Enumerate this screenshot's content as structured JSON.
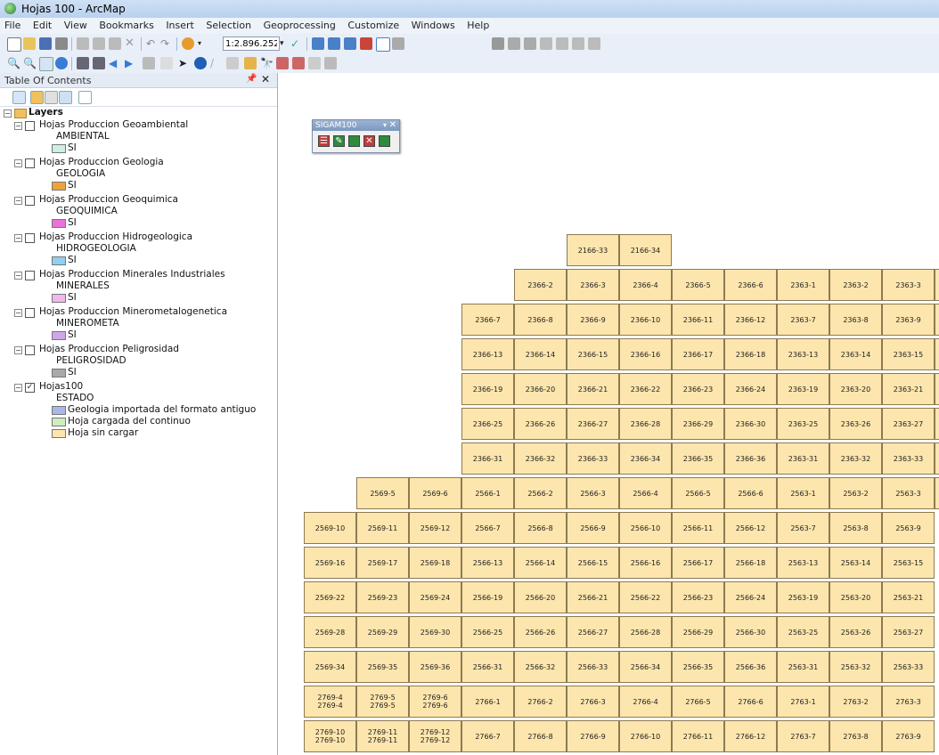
{
  "window": {
    "title": "Hojas 100 - ArcMap"
  },
  "menu": [
    "File",
    "Edit",
    "View",
    "Bookmarks",
    "Insert",
    "Selection",
    "Geoprocessing",
    "Customize",
    "Windows",
    "Help"
  ],
  "toolbar": {
    "scale": "1:2.896.252"
  },
  "toc": {
    "title": "Table Of Contents",
    "root": "Layers",
    "layers": [
      {
        "name": "Hojas Produccion Geoambiental",
        "field": "AMBIENTAL",
        "value": "SI",
        "color": "#c9f0e3",
        "checked": false
      },
      {
        "name": "Hojas Produccion Geologia",
        "field": "GEOLOGIA",
        "value": "SI",
        "color": "#f0a23a",
        "checked": false
      },
      {
        "name": "Hojas Produccion Geoquimica",
        "field": "GEOQUIMICA",
        "value": "SI",
        "color": "#e872d8",
        "checked": false
      },
      {
        "name": "Hojas Produccion Hidrogeologica",
        "field": "HIDROGEOLOGIA",
        "value": "SI",
        "color": "#8fd0ee",
        "checked": false
      },
      {
        "name": "Hojas Produccion Minerales Industriales",
        "field": "MINERALES",
        "value": "SI",
        "color": "#f2b8ee",
        "checked": false
      },
      {
        "name": "Hojas Produccion Minerometalogenetica",
        "field": "MINEROMETA",
        "value": "SI",
        "color": "#cfa7e6",
        "checked": false
      },
      {
        "name": "Hojas Produccion Peligrosidad",
        "field": "PELIGROSIDAD",
        "value": "SI",
        "color": "#a9a9a9",
        "checked": false
      }
    ],
    "hojas": {
      "name": "Hojas100",
      "field": "ESTADO",
      "checked": true,
      "classes": [
        {
          "label": "Geologia importada del formato antiguo",
          "color": "#a9b8e8"
        },
        {
          "label": "Hoja cargada del continuo",
          "color": "#cdeec0"
        },
        {
          "label": "Hoja sin cargar",
          "color": "#fde6ad"
        }
      ]
    }
  },
  "sigam": {
    "title": "SIGAM100",
    "buttons": [
      {
        "icon": "list-icon",
        "color": "#c23b3b",
        "glyph": "☰"
      },
      {
        "icon": "edit-pencil-icon",
        "color": "#2e8b3b",
        "glyph": "✎"
      },
      {
        "icon": "add-icon",
        "color": "#2e8b3b",
        "glyph": ""
      },
      {
        "icon": "delete-icon",
        "color": "#c23b3b",
        "glyph": "✕"
      },
      {
        "icon": "stop-icon",
        "color": "#2e8b3b",
        "glyph": ""
      }
    ]
  },
  "map": {
    "row0": {
      "cols": [
        5,
        6
      ],
      "labels": [
        "2166-33",
        "2166-34"
      ]
    },
    "rows": [
      {
        "cols": [
          4,
          5,
          6,
          7,
          8,
          9,
          10,
          11,
          12
        ],
        "labels": [
          "2366-2",
          "2366-3",
          "2366-4",
          "2366-5",
          "2366-6",
          "2363-1",
          "2363-2",
          "2363-3"
        ]
      },
      {
        "cols": [
          3,
          4,
          5,
          6,
          7,
          8,
          9,
          10,
          11,
          12
        ],
        "labels": [
          "2366-7",
          "2366-8",
          "2366-9",
          "2366-10",
          "2366-11",
          "2366-12",
          "2363-7",
          "2363-8",
          "2363-9"
        ]
      },
      {
        "cols": [
          3,
          4,
          5,
          6,
          7,
          8,
          9,
          10,
          11,
          12
        ],
        "labels": [
          "2366-13",
          "2366-14",
          "2366-15",
          "2366-16",
          "2366-17",
          "2366-18",
          "2363-13",
          "2363-14",
          "2363-15"
        ]
      },
      {
        "cols": [
          3,
          4,
          5,
          6,
          7,
          8,
          9,
          10,
          11,
          12
        ],
        "labels": [
          "2366-19",
          "2366-20",
          "2366-21",
          "2366-22",
          "2366-23",
          "2366-24",
          "2363-19",
          "2363-20",
          "2363-21"
        ]
      },
      {
        "cols": [
          3,
          4,
          5,
          6,
          7,
          8,
          9,
          10,
          11,
          12
        ],
        "labels": [
          "2366-25",
          "2366-26",
          "2366-27",
          "2366-28",
          "2366-29",
          "2366-30",
          "2363-25",
          "2363-26",
          "2363-27"
        ]
      },
      {
        "cols": [
          3,
          4,
          5,
          6,
          7,
          8,
          9,
          10,
          11,
          12
        ],
        "labels": [
          "2366-31",
          "2366-32",
          "2366-33",
          "2366-34",
          "2366-35",
          "2366-36",
          "2363-31",
          "2363-32",
          "2363-33"
        ]
      },
      {
        "cols": [
          1,
          2,
          3,
          4,
          5,
          6,
          7,
          8,
          9,
          10,
          11,
          12
        ],
        "labels": [
          "2569-5",
          "2569-6",
          "2566-1",
          "2566-2",
          "2566-3",
          "2566-4",
          "2566-5",
          "2566-6",
          "2563-1",
          "2563-2",
          "2563-3"
        ]
      },
      {
        "cols": [
          0,
          1,
          2,
          3,
          4,
          5,
          6,
          7,
          8,
          9,
          10,
          11
        ],
        "labels": [
          "2569-10",
          "2569-11",
          "2569-12",
          "2566-7",
          "2566-8",
          "2566-9",
          "2566-10",
          "2566-11",
          "2566-12",
          "2563-7",
          "2563-8",
          "2563-9"
        ]
      },
      {
        "cols": [
          0,
          1,
          2,
          3,
          4,
          5,
          6,
          7,
          8,
          9,
          10,
          11
        ],
        "labels": [
          "2569-16",
          "2569-17",
          "2569-18",
          "2566-13",
          "2566-14",
          "2566-15",
          "2566-16",
          "2566-17",
          "2566-18",
          "2563-13",
          "2563-14",
          "2563-15"
        ]
      },
      {
        "cols": [
          0,
          1,
          2,
          3,
          4,
          5,
          6,
          7,
          8,
          9,
          10,
          11
        ],
        "labels": [
          "2569-22",
          "2569-23",
          "2569-24",
          "2566-19",
          "2566-20",
          "2566-21",
          "2566-22",
          "2566-23",
          "2566-24",
          "2563-19",
          "2563-20",
          "2563-21"
        ]
      },
      {
        "cols": [
          0,
          1,
          2,
          3,
          4,
          5,
          6,
          7,
          8,
          9,
          10,
          11
        ],
        "labels": [
          "2569-28",
          "2569-29",
          "2569-30",
          "2566-25",
          "2566-26",
          "2566-27",
          "2566-28",
          "2566-29",
          "2566-30",
          "2563-25",
          "2563-26",
          "2563-27"
        ]
      },
      {
        "cols": [
          0,
          1,
          2,
          3,
          4,
          5,
          6,
          7,
          8,
          9,
          10,
          11
        ],
        "labels": [
          "2569-34",
          "2569-35",
          "2569-36",
          "2566-31",
          "2566-32",
          "2566-33",
          "2566-34",
          "2566-35",
          "2566-36",
          "2563-31",
          "2563-32",
          "2563-33"
        ]
      },
      {
        "cols": [
          0,
          1,
          2,
          3,
          4,
          5,
          6,
          7,
          8,
          9,
          10,
          11
        ],
        "labels": [
          "2769-4\n2769-4",
          "2769-5\n2769-5",
          "2769-6\n2769-6",
          "2766-1",
          "2766-2",
          "2766-3",
          "2766-4",
          "2766-5",
          "2766-6",
          "2763-1",
          "2763-2",
          "2763-3"
        ]
      },
      {
        "cols": [
          0,
          1,
          2,
          3,
          4,
          5,
          6,
          7,
          8,
          9,
          10,
          11
        ],
        "labels": [
          "2769-10\n2769-10",
          "2769-11\n2769-11",
          "2769-12\n2769-12",
          "2766-7",
          "2766-8",
          "2766-9",
          "2766-10",
          "2766-11",
          "2766-12",
          "2763-7",
          "2763-8",
          "2763-9"
        ]
      }
    ]
  }
}
